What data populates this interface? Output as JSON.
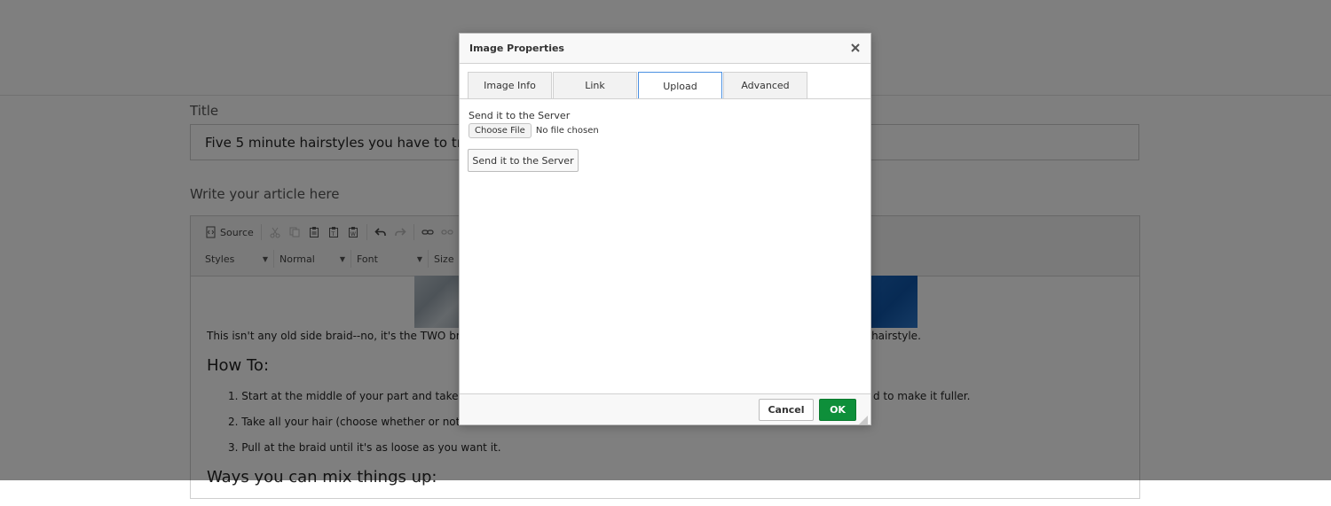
{
  "page": {
    "title_label": "Title",
    "title_value": "Five 5 minute hairstyles you have to try in 201",
    "article_label": "Write your article here"
  },
  "editor": {
    "toolbar": {
      "source_label": "Source",
      "styles_label": "Styles",
      "format_label": "Normal",
      "font_label": "Font",
      "size_label": "Size"
    },
    "content": {
      "intro_left": "This isn't any old side braid--no, it's the TWO braid side",
      "intro_right": "s hairstyle.",
      "heading_howto": "How To:",
      "step1_left": "1. Start at the middle of your part and take about th",
      "step1_right": "d to make it fuller.",
      "step2_left": "2. Take all your hair (choose whether or not to untie",
      "step2_right": "",
      "step3": "3. Pull at the braid until it's as loose as you want it.",
      "heading_mix": "Ways you can mix things up:"
    }
  },
  "dialog": {
    "title": "Image Properties",
    "tabs": [
      {
        "label": "Image Info"
      },
      {
        "label": "Link"
      },
      {
        "label": "Upload"
      },
      {
        "label": "Advanced"
      }
    ],
    "active_tab": "Upload",
    "upload": {
      "label": "Send it to the Server",
      "choose_file_label": "Choose File",
      "file_status": "No file chosen",
      "send_button_label": "Send it to the Server"
    },
    "footer": {
      "cancel_label": "Cancel",
      "ok_label": "OK"
    }
  },
  "colors": {
    "ok_green": "#0e8f3a",
    "tab_active_border": "#4a90e2",
    "overlay": "rgba(0,0,0,0.5)",
    "image_blue": "#1565c0"
  },
  "icons": {
    "source": "source-icon",
    "cut": "cut-icon",
    "copy": "copy-icon",
    "paste": "paste-icon",
    "paste_text": "paste-text-icon",
    "paste_word": "paste-word-icon",
    "undo": "undo-icon",
    "redo": "redo-icon",
    "link": "link-icon",
    "unlink": "unlink-icon",
    "close": "close-icon"
  }
}
